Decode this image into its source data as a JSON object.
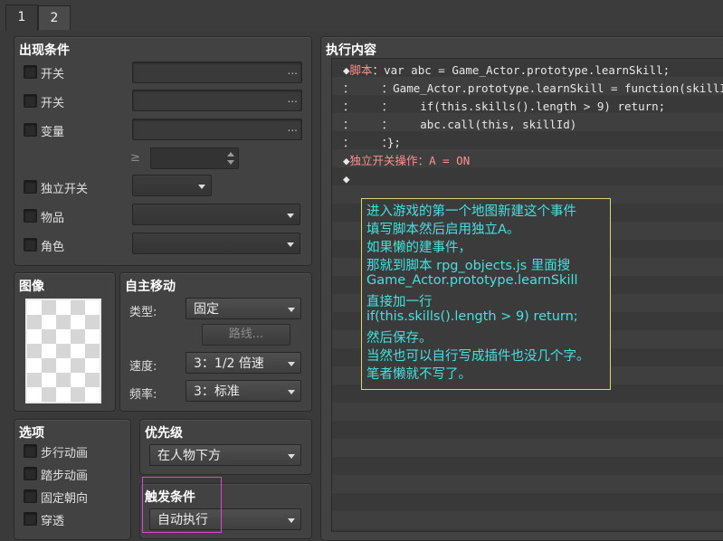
{
  "tabs": [
    "1",
    "2"
  ],
  "conditions": {
    "title": "出现条件",
    "switch1": "开关",
    "switch2": "开关",
    "variable": "变量",
    "gte": "≥",
    "self_switch": "独立开关",
    "item": "物品",
    "actor": "角色",
    "dots": "..."
  },
  "image": {
    "title": "图像"
  },
  "auto_move": {
    "title": "自主移动",
    "type_label": "类型:",
    "type_value": "固定",
    "route_button": "路线...",
    "speed_label": "速度:",
    "speed_value": "3：1/2 倍速",
    "freq_label": "频率:",
    "freq_value": "3：标准"
  },
  "options": {
    "title": "选项",
    "walking": "步行动画",
    "stepping": "踏步动画",
    "direction_fix": "固定朝向",
    "through": "穿透"
  },
  "priority": {
    "title": "优先级",
    "value": "在人物下方"
  },
  "trigger": {
    "title": "触发条件",
    "value": "自动执行"
  },
  "contents": {
    "title": "执行内容",
    "lines": [
      {
        "prefix": "◆",
        "label": "脚本",
        "sep": "：",
        "text": "var abc = Game_Actor.prototype.learnSkill;"
      },
      {
        "prefix": "：",
        "label": "    ",
        "sep": "：",
        "text": "Game_Actor.prototype.learnSkill = function(skillId) {"
      },
      {
        "prefix": "：",
        "label": "    ",
        "sep": "：",
        "text": "    if(this.skills().length > 9) return;"
      },
      {
        "prefix": "：",
        "label": "    ",
        "sep": "：",
        "text": "    abc.call(this, skillId)"
      },
      {
        "prefix": "：",
        "label": "    ",
        "sep": "：",
        "text": "};"
      },
      {
        "prefix": "◆",
        "label": "独立开关操作",
        "sep": "：",
        "text": "A = ON"
      },
      {
        "prefix": "◆",
        "label": "",
        "sep": "",
        "text": ""
      }
    ]
  },
  "note": {
    "lines": [
      "进入游戏的第一个地图新建这个事件",
      "填写脚本然后启用独立A。",
      "如果懒的建事件，",
      "那就到脚本 rpg_objects.js 里面搜",
      "Game_Actor.prototype.learnSkill",
      "直接加一行",
      "if(this.skills().length > 9) return;",
      "然后保存。",
      "当然也可以自行写成插件也没几个字。",
      "笔者懒就不写了。"
    ]
  },
  "colors": {
    "note_text": "#46e0e0",
    "note_border": "#d8d87a",
    "command_label": "#ff8f8f",
    "highlight_box": "#e040e0"
  }
}
